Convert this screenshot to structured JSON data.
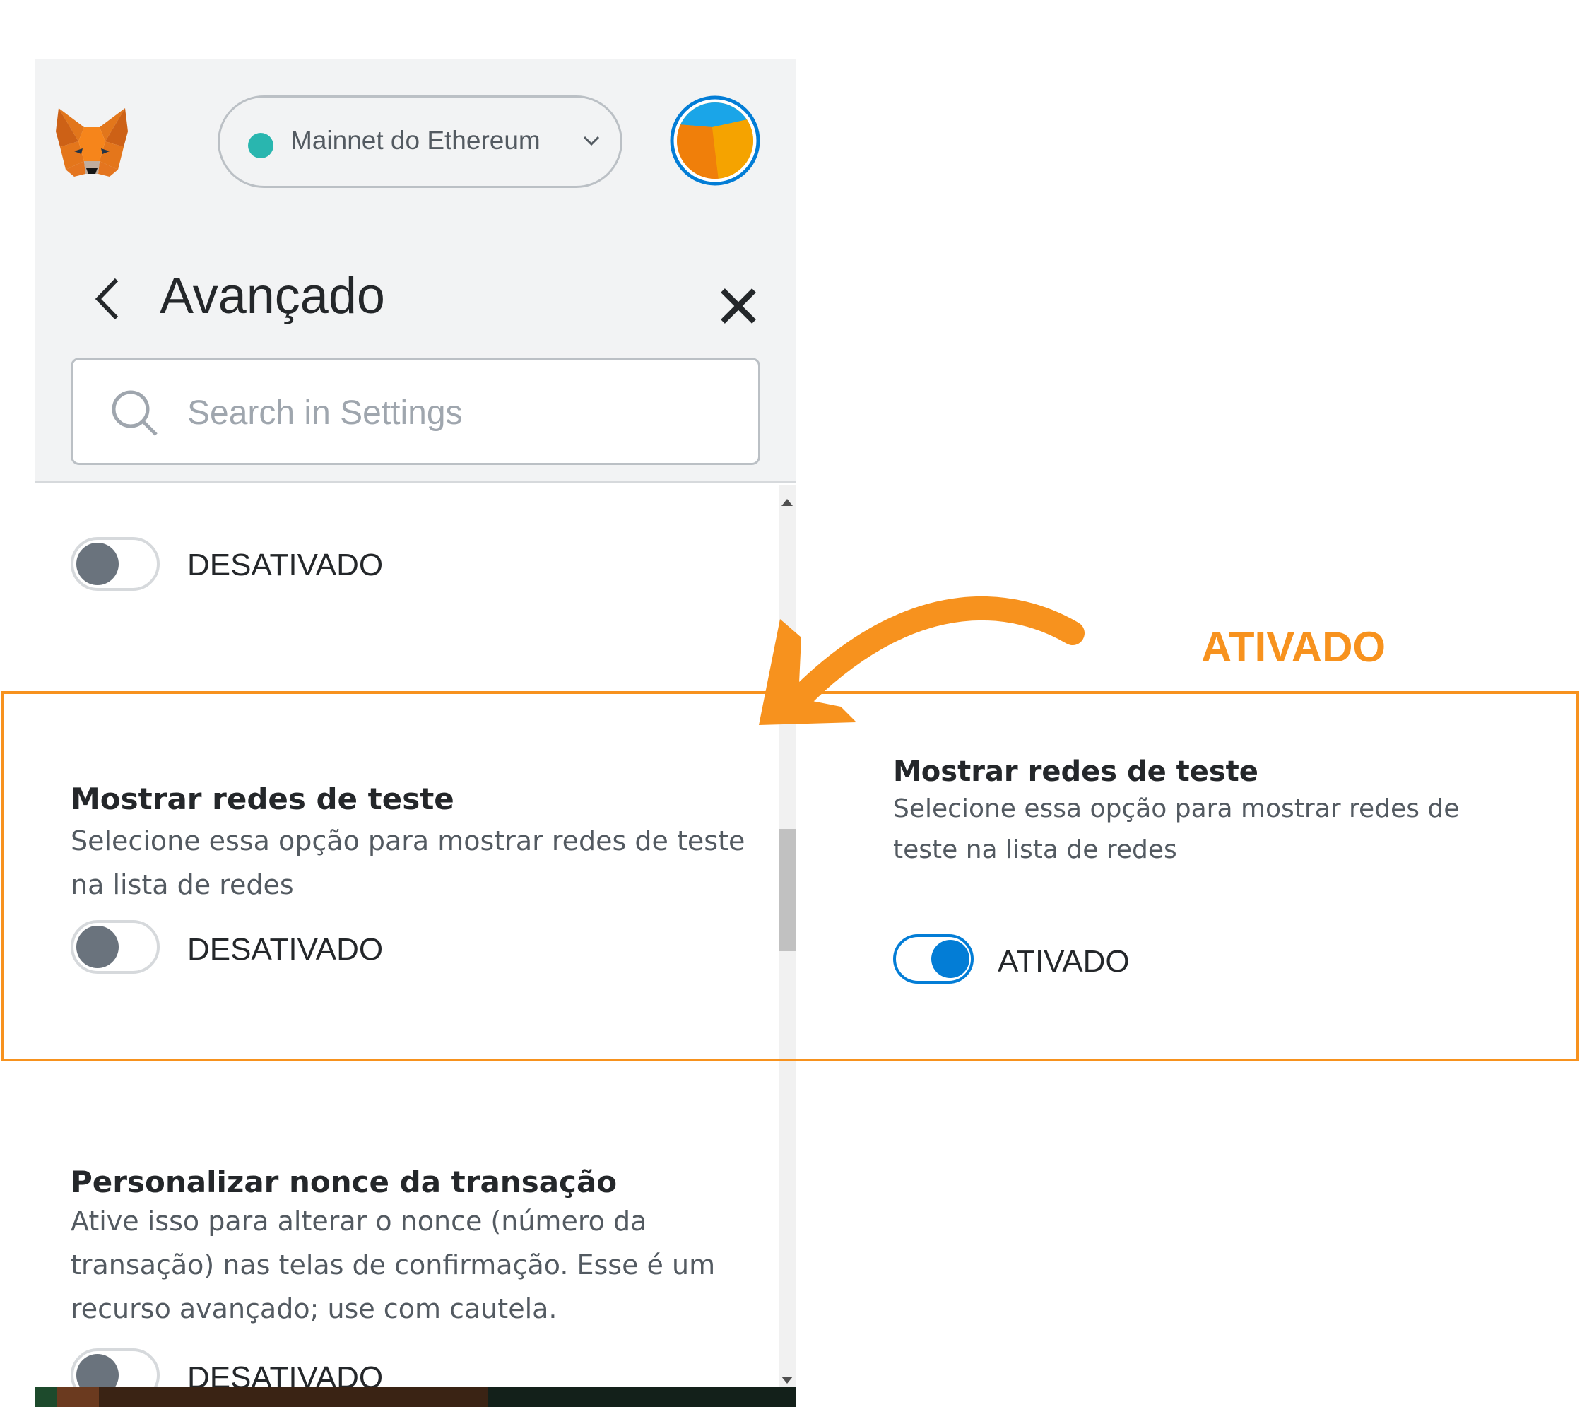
{
  "header": {
    "network_label": "Mainnet do Ethereum",
    "title": "Avançado",
    "search_placeholder": "Search in Settings"
  },
  "settings": [
    {
      "toggle_state": "off",
      "toggle_label": "DESATIVADO"
    },
    {
      "title": "Mostrar redes de teste",
      "description": "Selecione essa opção para mostrar redes de teste na lista de redes",
      "toggle_state": "off",
      "toggle_label": "DESATIVADO"
    },
    {
      "title": "Personalizar nonce da transação",
      "description": "Ative isso para alterar o nonce (número da transação) nas telas de confirmação. Esse é um recurso avançado; use com cautela.",
      "toggle_state": "off",
      "toggle_label": "DESATIVADO"
    }
  ],
  "annotation": {
    "label": "ATIVADO",
    "color": "#f7921e"
  },
  "preview": {
    "title": "Mostrar redes de teste",
    "description": "Selecione essa opção para mostrar redes de teste na lista de redes",
    "toggle_state": "on",
    "toggle_label": "ATIVADO"
  },
  "colors": {
    "accent_blue": "#037dd6",
    "network_dot": "#29b6af",
    "header_bg": "#f2f3f4"
  },
  "icons": [
    "metamask-fox-icon",
    "chevron-down-icon",
    "account-avatar",
    "back-arrow-icon",
    "close-icon",
    "search-icon",
    "annotation-arrow"
  ]
}
